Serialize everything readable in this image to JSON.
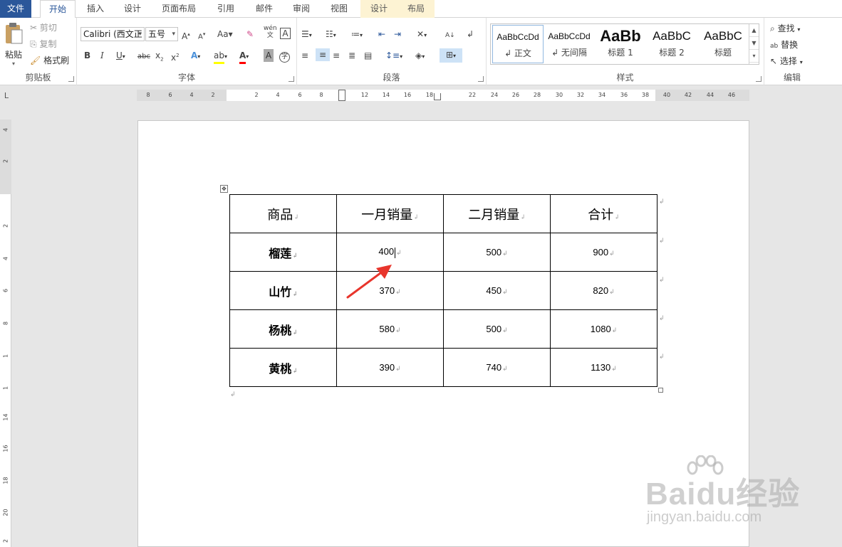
{
  "tabs": [
    {
      "label": "文件"
    },
    {
      "label": "开始"
    },
    {
      "label": "插入"
    },
    {
      "label": "设计"
    },
    {
      "label": "页面布局"
    },
    {
      "label": "引用"
    },
    {
      "label": "邮件"
    },
    {
      "label": "审阅"
    },
    {
      "label": "视图"
    },
    {
      "label": "设计"
    },
    {
      "label": "布局"
    }
  ],
  "ribbon": {
    "clipboard": {
      "label": "剪贴板",
      "paste": "粘贴",
      "cut": "剪切",
      "copy": "复制",
      "format_painter": "格式刷"
    },
    "font": {
      "label": "字体",
      "font_name": "Calibri (西文正",
      "font_size": "五号"
    },
    "paragraph": {
      "label": "段落"
    },
    "styles": {
      "label": "样式",
      "items": [
        {
          "sample": "AaBbCcDd",
          "name": "↲ 正文"
        },
        {
          "sample": "AaBbCcDd",
          "name": "↲ 无间隔"
        },
        {
          "sample": "AaBb",
          "name": "标题 1"
        },
        {
          "sample": "AaBbC",
          "name": "标题 2"
        },
        {
          "sample": "AaBbC",
          "name": "标题"
        }
      ]
    },
    "editing": {
      "label": "编辑",
      "find": "查找",
      "replace": "替换",
      "select": "选择"
    }
  },
  "ruler": {
    "h_ticks": [
      "8",
      "6",
      "4",
      "2",
      "2",
      "4",
      "6",
      "8",
      "12",
      "14",
      "16",
      "18",
      "22",
      "24",
      "26",
      "28",
      "30",
      "32",
      "34",
      "36",
      "38",
      "40",
      "42",
      "44",
      "46"
    ],
    "v_ticks": [
      "4",
      "2",
      "2",
      "4",
      "6",
      "8",
      "1",
      "1",
      "14",
      "16",
      "18",
      "20",
      "2"
    ]
  },
  "table": {
    "headers": [
      "商品",
      "一月销量",
      "二月销量",
      "合计"
    ],
    "rows": [
      [
        "榴莲",
        "400",
        "500",
        "900"
      ],
      [
        "山竹",
        "370",
        "450",
        "820"
      ],
      [
        "杨桃",
        "580",
        "500",
        "1080"
      ],
      [
        "黄桃",
        "390",
        "740",
        "1130"
      ]
    ]
  },
  "watermark": {
    "brand": "Baidu经验",
    "url": "jingyan.baidu.com"
  },
  "colors": {
    "accent": "#2b579a",
    "arrow": "#e8352c",
    "highlight": "#ffff00",
    "font_color": "#ff0000"
  }
}
